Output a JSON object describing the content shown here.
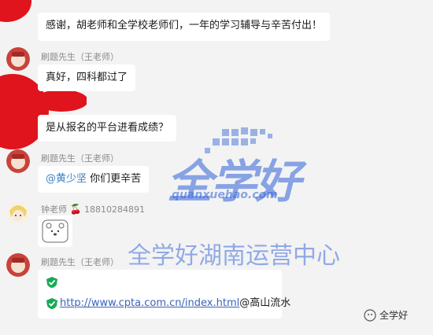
{
  "messages": [
    {
      "text": "感谢，胡老师和全学校老师们，一年的学习辅导与辛苦付出！"
    },
    {
      "sender": "刷题先生（王老师）",
      "text": "真好，四科都过了"
    },
    {
      "text": "是从报名的平台进看成绩？"
    },
    {
      "sender": "刷题先生（王老师）",
      "mention": "@黄少坚",
      "text": " 你们更辛苦"
    },
    {
      "sender": "钟老师",
      "sender_suffix": "18810284891"
    },
    {
      "sender": "刷题先生（王老师）",
      "link": "http://www.cpta.com.cn/index.html",
      "link_suffix": "@高山流水"
    }
  ],
  "watermark": {
    "logo_text": "全学好",
    "domain": "quanxuehao.com",
    "center_text": "全学好湖南运营中心",
    "corner_label": "全学好"
  },
  "colors": {
    "background": "#f3f3f3",
    "bubble": "#ffffff",
    "watermark_blue": "#2f62d8",
    "check_green": "#19a957"
  }
}
